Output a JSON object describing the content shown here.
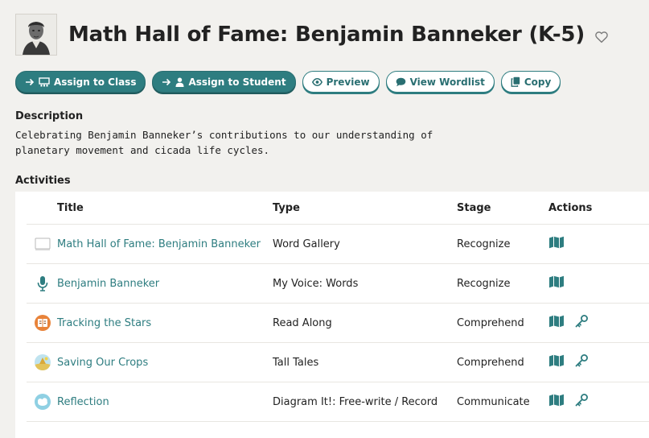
{
  "header": {
    "title": "Math Hall of Fame: Benjamin Banneker (K-5)"
  },
  "actions": {
    "assign_class": "Assign to Class",
    "assign_student": "Assign to Student",
    "preview": "Preview",
    "view_wordlist": "View Wordlist",
    "copy": "Copy"
  },
  "description": {
    "heading": "Description",
    "line1": "Celebrating Benjamin Banneker’s contributions to our understanding of",
    "line2": "planetary movement and cicada life cycles."
  },
  "activities": {
    "heading": "Activities",
    "columns": {
      "title": "Title",
      "type": "Type",
      "stage": "Stage",
      "actions": "Actions"
    },
    "rows": [
      {
        "icon": "word-gallery-icon",
        "title": "Math Hall of Fame: Benjamin Banneker",
        "type": "Word Gallery",
        "stage": "Recognize",
        "has_key": false
      },
      {
        "icon": "microphone-icon",
        "title": "Benjamin Banneker",
        "type": "My Voice: Words",
        "stage": "Recognize",
        "has_key": false
      },
      {
        "icon": "read-along-icon",
        "title": "Tracking the Stars",
        "type": "Read Along",
        "stage": "Comprehend",
        "has_key": true
      },
      {
        "icon": "tall-tales-icon",
        "title": "Saving Our Crops",
        "type": "Tall Tales",
        "stage": "Comprehend",
        "has_key": true
      },
      {
        "icon": "diagram-icon",
        "title": "Reflection",
        "type": "Diagram It!: Free-write / Record",
        "stage": "Communicate",
        "has_key": true
      }
    ]
  },
  "colors": {
    "accent": "#2e7d80",
    "background": "#f2f1ee"
  }
}
